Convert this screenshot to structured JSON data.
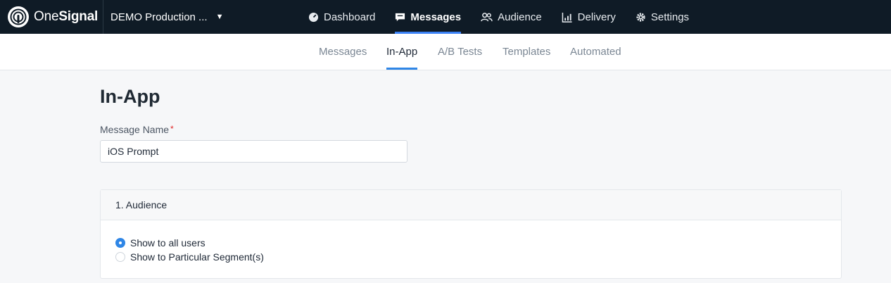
{
  "brand": {
    "text_light": "One",
    "text_bold": "Signal"
  },
  "app_switcher": {
    "label": "DEMO Production ..."
  },
  "main_nav": {
    "dashboard": "Dashboard",
    "messages": "Messages",
    "audience": "Audience",
    "delivery": "Delivery",
    "settings": "Settings",
    "active": "Messages"
  },
  "sub_nav": {
    "messages": "Messages",
    "in_app": "In-App",
    "ab_tests": "A/B Tests",
    "templates": "Templates",
    "automated": "Automated",
    "active": "In-App"
  },
  "page": {
    "title": "In-App"
  },
  "message_name": {
    "label": "Message Name",
    "required_mark": "*",
    "value": "iOS Prompt"
  },
  "audience": {
    "header": "1. Audience",
    "option_all": "Show to all users",
    "option_segment": "Show to Particular Segment(s)",
    "selected": "Show to all users"
  },
  "colors": {
    "topbar": "#0f1b26",
    "accent": "#2f86e6",
    "required": "#e02424"
  }
}
